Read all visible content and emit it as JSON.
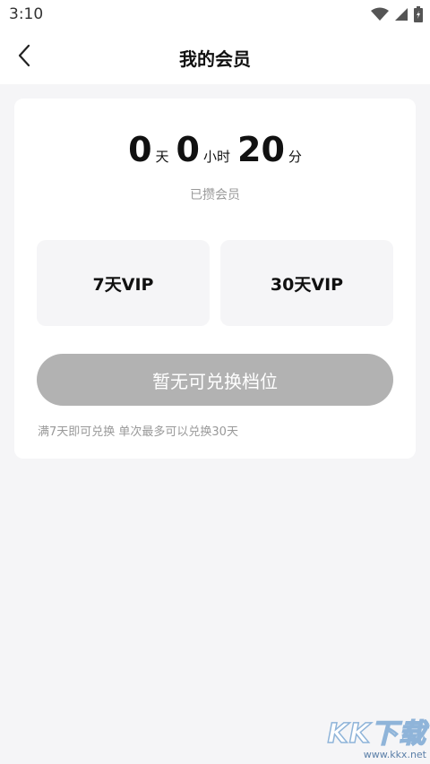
{
  "status_bar": {
    "time": "3:10",
    "icons": [
      "wifi-icon",
      "signal-icon",
      "battery-icon"
    ]
  },
  "nav": {
    "title": "我的会员",
    "back_icon": "chevron-left-icon"
  },
  "membership": {
    "countdown": {
      "days": "0",
      "days_unit": "天",
      "hours": "0",
      "hours_unit": "小时",
      "minutes": "20",
      "minutes_unit": "分"
    },
    "subtitle": "已攒会员",
    "plans": [
      {
        "label": "7天VIP"
      },
      {
        "label": "30天VIP"
      }
    ],
    "redeem_button": "暂无可兑换档位",
    "hint": "满7天即可兑换 单次最多可以兑换30天"
  },
  "watermark": {
    "logo": "KK下载",
    "url": "www.kkx.net"
  },
  "colors": {
    "background": "#f5f5f7",
    "card": "#ffffff",
    "button_disabled": "#b2b2b2",
    "muted_text": "#999999"
  }
}
